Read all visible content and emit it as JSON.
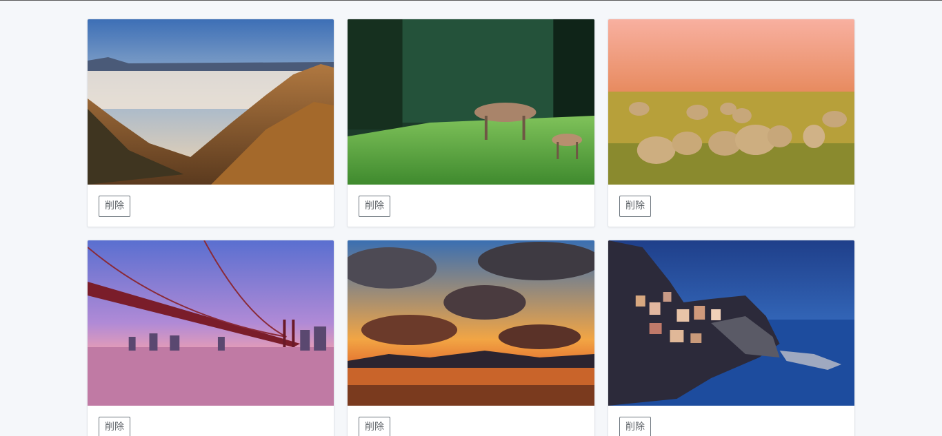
{
  "cards": [
    {
      "image": "mountain-sea-of-clouds-photo",
      "delete_label": "削除"
    },
    {
      "image": "deer-in-meadow-photo",
      "delete_label": "削除"
    },
    {
      "image": "sheep-grazing-photo",
      "delete_label": "削除"
    },
    {
      "image": "suspension-bridge-dusk-photo",
      "delete_label": "削除"
    },
    {
      "image": "sunset-clouds-over-sea-photo",
      "delete_label": "削除"
    },
    {
      "image": "cliffside-village-night-photo",
      "delete_label": "削除"
    }
  ],
  "colors": {
    "page_bg": "#f5f7fa",
    "button_border": "#6c757d",
    "button_text": "#5f6469"
  }
}
